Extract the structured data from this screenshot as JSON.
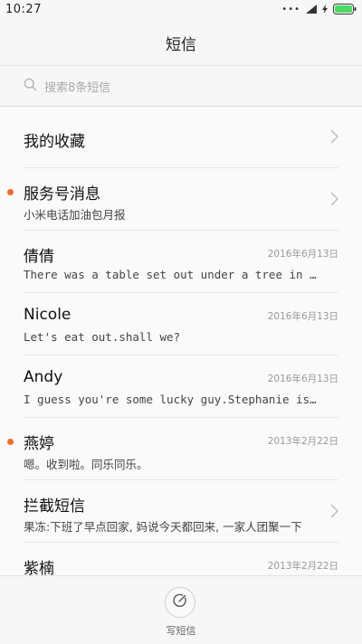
{
  "status_bar": {
    "time": "10:27",
    "signal_dots": "•••"
  },
  "header": {
    "title": "短信"
  },
  "search": {
    "placeholder": "搜索8条短信"
  },
  "conversations": [
    {
      "title": "我的收藏",
      "preview": "",
      "date": "",
      "unread": false,
      "chevron": true
    },
    {
      "title": "服务号消息",
      "preview": "小米电话加油包月报",
      "date": "",
      "unread": true,
      "chevron": true
    },
    {
      "title": "倩倩",
      "preview": "There was a table set out under a tree in front of the house",
      "date": "2016年6月13日",
      "unread": false,
      "chevron": false
    },
    {
      "title": "Nicole",
      "preview": "Let's eat out.shall we?",
      "date": "2016年6月13日",
      "unread": false,
      "chevron": false
    },
    {
      "title": "Andy",
      "preview": "I guess you're some lucky guy.Stephanie is a nice girl",
      "date": "2016年6月13日",
      "unread": false,
      "chevron": false
    },
    {
      "title": "燕婷",
      "preview": "嗯。收到啦。同乐同乐。",
      "date": "2013年2月22日",
      "unread": true,
      "chevron": false
    },
    {
      "title": "拦截短信",
      "preview": "果冻:下班了早点回家, 妈说今天都回来, 一家人团聚一下",
      "date": "",
      "unread": false,
      "chevron": true
    },
    {
      "title": "紫楠",
      "preview": "",
      "date": "2013年2月22日",
      "unread": false,
      "chevron": false
    }
  ],
  "bottom": {
    "compose_label": "写短信"
  },
  "colors": {
    "unread_dot": "#f26b2a",
    "battery": "#4cd964"
  }
}
